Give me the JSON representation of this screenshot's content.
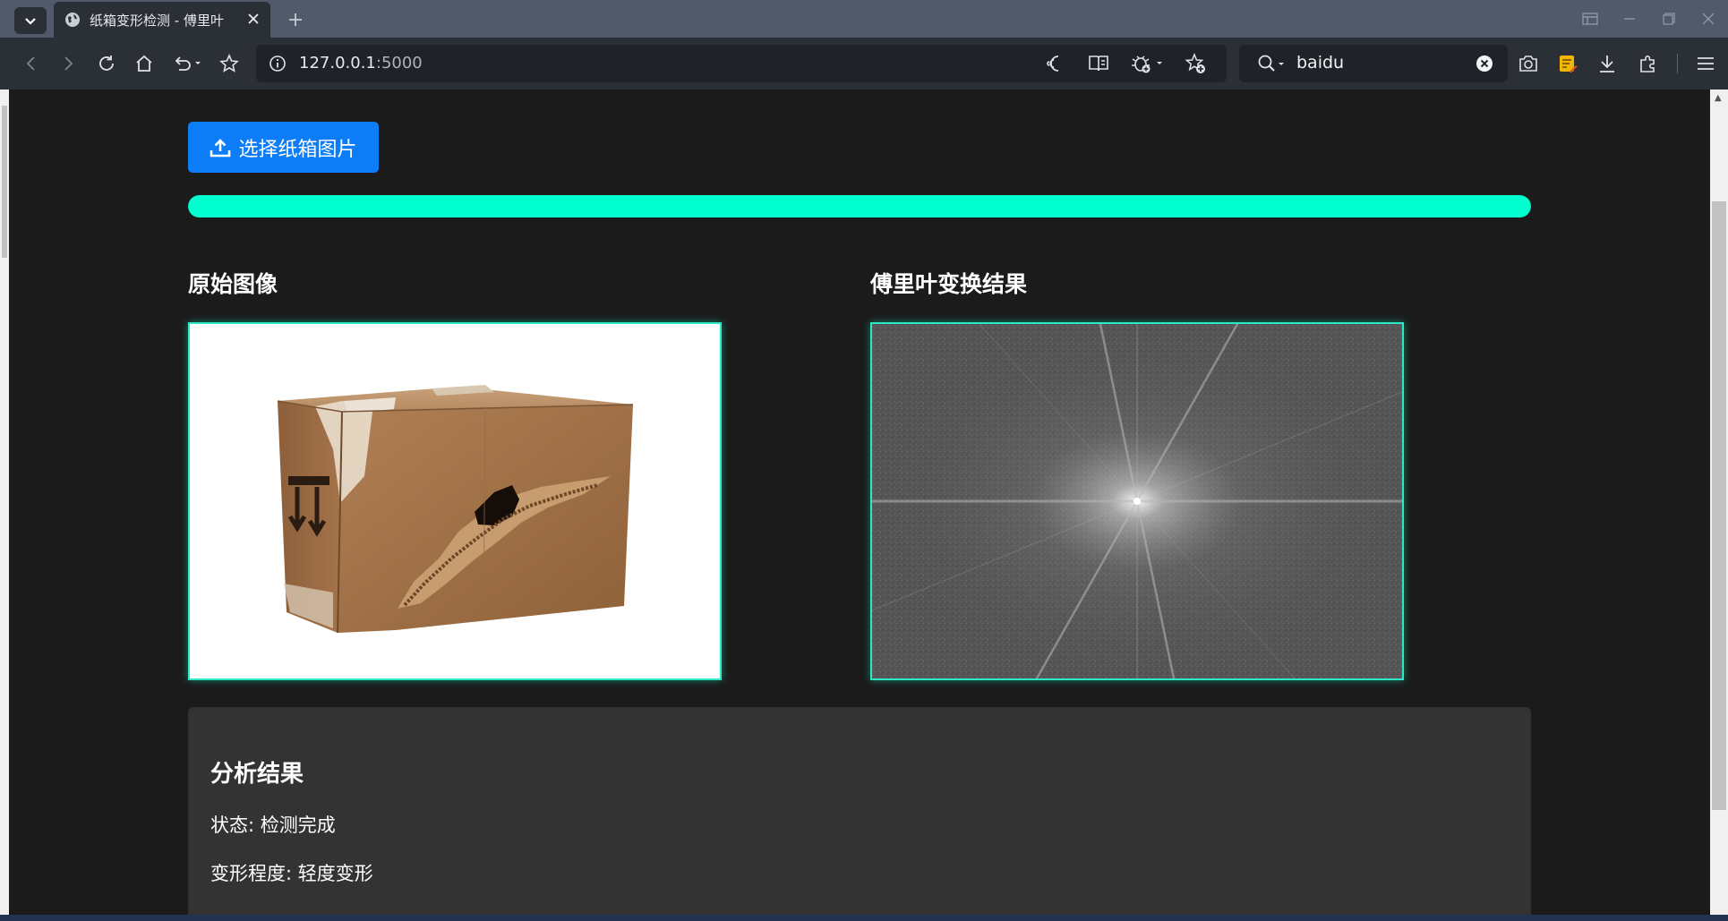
{
  "browser": {
    "tab_title": "纸箱变形检测 - 傅里叶",
    "url_host": "127.0.0.1",
    "url_port": ":5000",
    "search_value": "baidu"
  },
  "page": {
    "upload_button_label": "选择纸箱图片",
    "progress_percent": 100,
    "progress_color": "#00ffcf",
    "original_title": "原始图像",
    "fft_title": "傅里叶变换结果",
    "analysis": {
      "title": "分析结果",
      "status_line": "状态: 检测完成",
      "degree_line": "变形程度: 轻度变形"
    }
  },
  "icons": [
    "tab-list-icon",
    "globe-icon",
    "close-icon",
    "new-tab-icon",
    "back-icon",
    "forward-icon",
    "reload-icon",
    "home-icon",
    "undo-icon",
    "bookmark-star-icon",
    "info-icon",
    "read-aloud-icon",
    "reader-mode-icon",
    "bug-icon",
    "favorite-add-icon",
    "search-icon",
    "clear-icon",
    "screenshot-icon",
    "notes-icon",
    "download-icon",
    "extensions-icon",
    "menu-icon",
    "upload-icon"
  ]
}
